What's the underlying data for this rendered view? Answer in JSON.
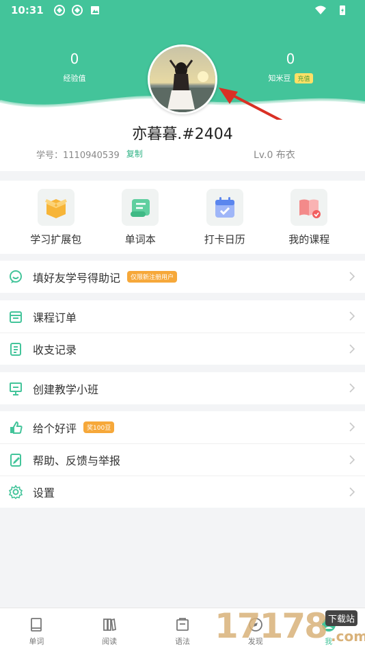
{
  "status_bar": {
    "time": "10:31"
  },
  "stats": {
    "exp": {
      "value": "0",
      "label": "经验值"
    },
    "beans": {
      "value": "0",
      "label": "知米豆",
      "recharge": "充值"
    }
  },
  "profile": {
    "name": "亦暮暮.#2404",
    "id_label": "学号：1110940539",
    "copy_label": "复制",
    "level": "Lv.0 布衣"
  },
  "shortcuts": [
    {
      "label": "学习扩展包",
      "icon": "package-icon"
    },
    {
      "label": "单词本",
      "icon": "scroll-icon"
    },
    {
      "label": "打卡日历",
      "icon": "calendar-icon"
    },
    {
      "label": "我的课程",
      "icon": "book-icon"
    }
  ],
  "menu": {
    "invite": {
      "label": "填好友学号得助记",
      "badge": "仅限新注册用户"
    },
    "orders": {
      "label": "课程订单"
    },
    "records": {
      "label": "收支记录"
    },
    "create_class": {
      "label": "创建教学小班"
    },
    "review": {
      "label": "给个好评",
      "badge": "奖100豆"
    },
    "help": {
      "label": "帮助、反馈与举报"
    },
    "settings": {
      "label": "设置"
    }
  },
  "tabs": [
    {
      "label": "单词"
    },
    {
      "label": "阅读"
    },
    {
      "label": "语法"
    },
    {
      "label": "发现"
    },
    {
      "label": "我"
    }
  ],
  "watermark": {
    "digits": "17178",
    "badge": "下载站",
    "com": ".com"
  },
  "colors": {
    "brand_green": "#43c49a",
    "accent_orange": "#f6a83a",
    "arrow_red": "#d93025"
  }
}
